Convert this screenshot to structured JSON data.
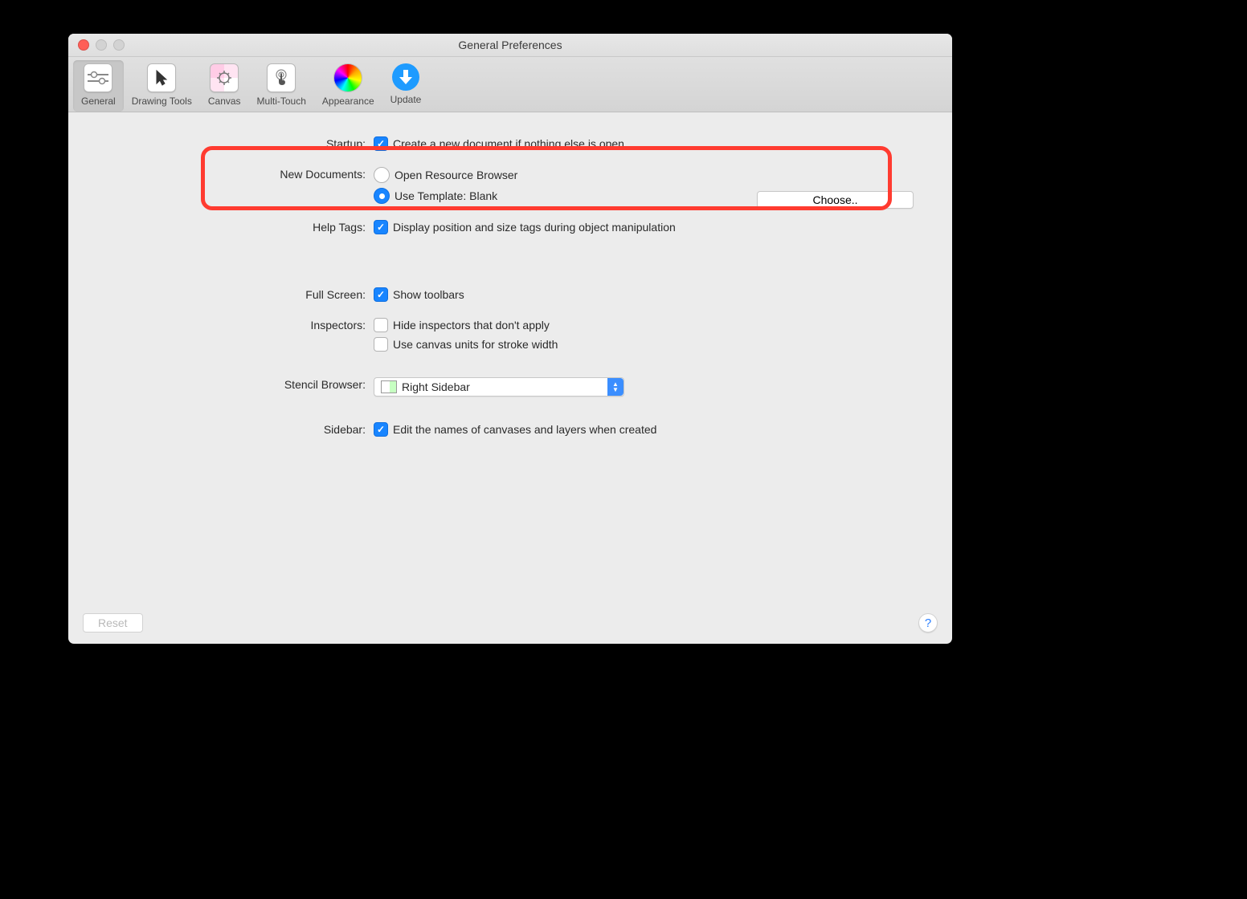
{
  "window": {
    "title": "General Preferences"
  },
  "tabs": {
    "general": "General",
    "drawing": "Drawing Tools",
    "canvas": "Canvas",
    "multitouch": "Multi-Touch",
    "appearance": "Appearance",
    "update": "Update"
  },
  "labels": {
    "startup": "Startup:",
    "newdocs": "New Documents:",
    "helptags": "Help Tags:",
    "fullscreen": "Full Screen:",
    "inspectors": "Inspectors:",
    "stencil": "Stencil Browser:",
    "sidebar": "Sidebar:"
  },
  "options": {
    "startup_create": "Create a new document if nothing else is open",
    "newdocs_resource": "Open Resource Browser",
    "newdocs_template": "Use Template: Blank",
    "choose": "Choose..",
    "helptags_display": "Display position and size tags during object manipulation",
    "fullscreen_toolbars": "Show toolbars",
    "inspectors_hide": "Hide inspectors that don't apply",
    "inspectors_canvasunits": "Use canvas units for stroke width",
    "stencil_value": "Right Sidebar",
    "sidebar_editnames": "Edit the names of canvases and layers when created"
  },
  "footer": {
    "reset": "Reset",
    "help": "?"
  }
}
